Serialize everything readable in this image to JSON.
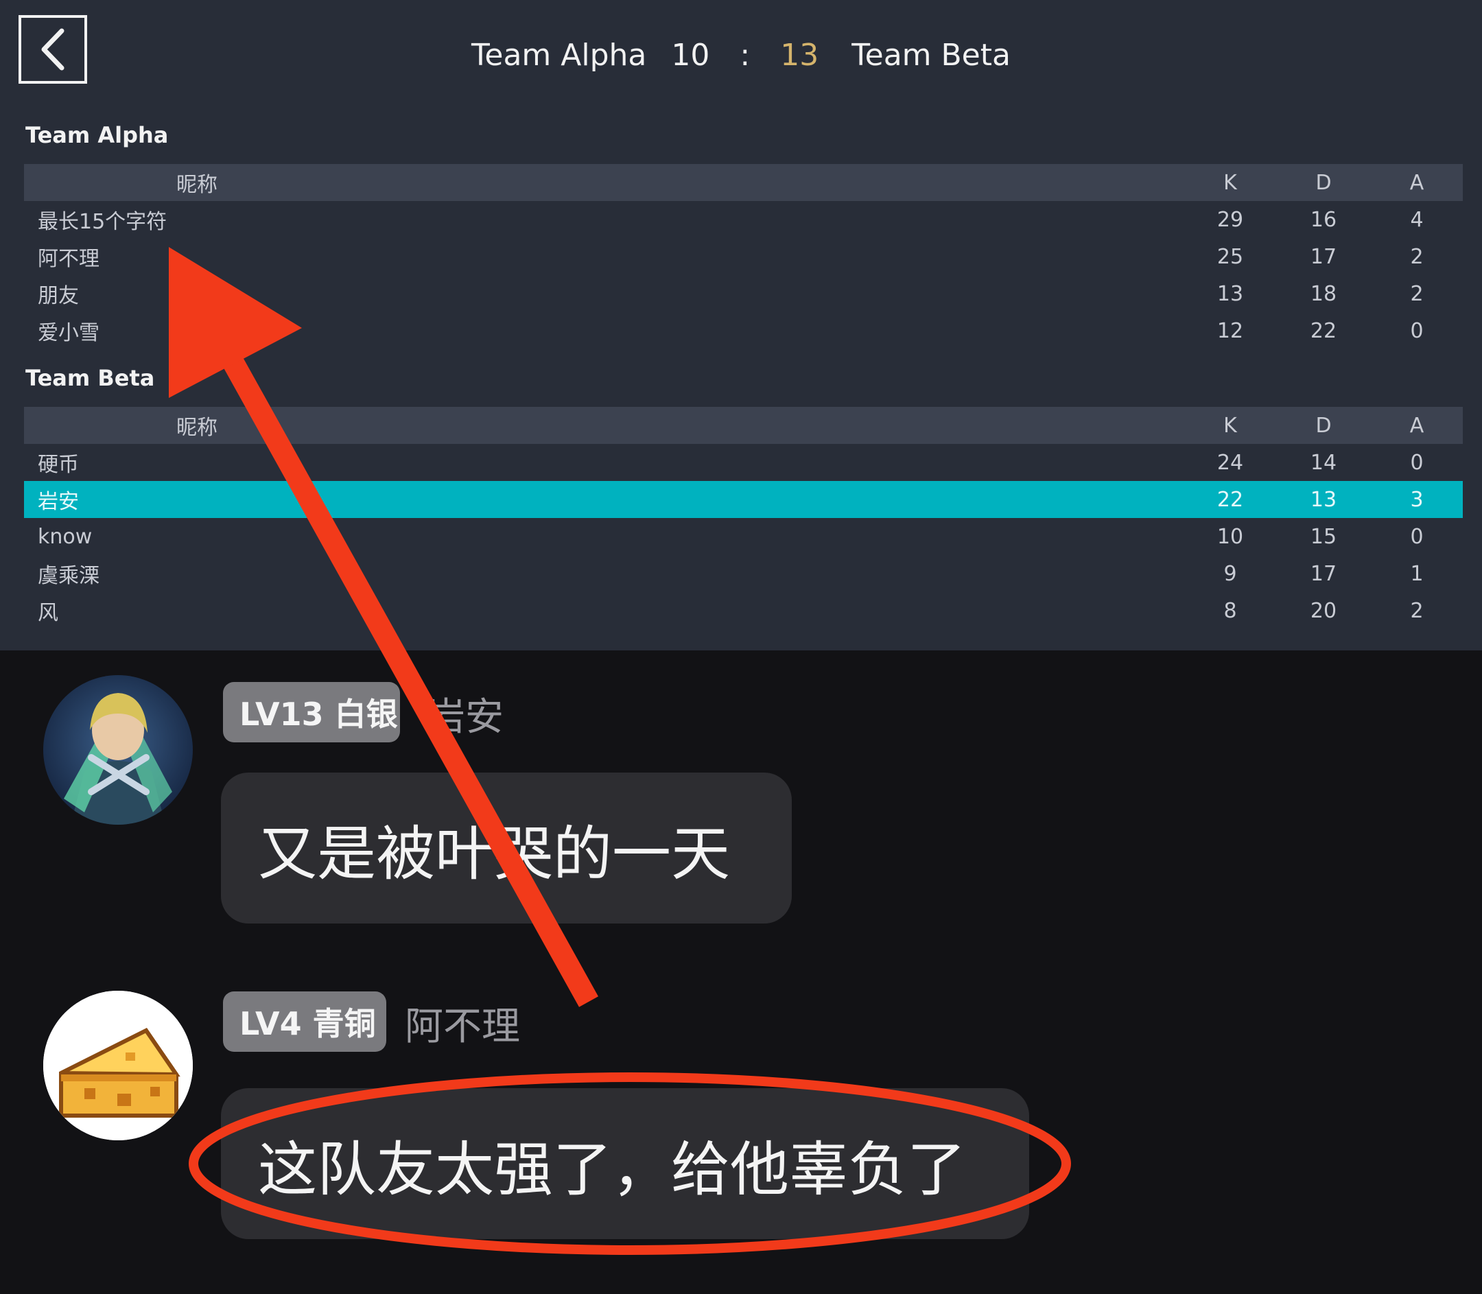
{
  "header": {
    "team_a": "Team Alpha",
    "score_a": "10",
    "separator": ":",
    "score_b": "13",
    "team_b": "Team Beta"
  },
  "teams": [
    {
      "title": "Team Alpha",
      "columns": {
        "name": "昵称",
        "k": "K",
        "d": "D",
        "a": "A"
      },
      "rows": [
        {
          "name": "最长15个字符",
          "k": "29",
          "d": "16",
          "a": "4"
        },
        {
          "name": "阿不理",
          "k": "25",
          "d": "17",
          "a": "2"
        },
        {
          "name": "朋友",
          "k": "13",
          "d": "18",
          "a": "2"
        },
        {
          "name": "爱小雪",
          "k": "12",
          "d": "22",
          "a": "0"
        }
      ]
    },
    {
      "title": "Team Beta",
      "columns": {
        "name": "昵称",
        "k": "K",
        "d": "D",
        "a": "A"
      },
      "rows": [
        {
          "name": "硬币",
          "k": "24",
          "d": "14",
          "a": "0"
        },
        {
          "name": "岩安",
          "k": "22",
          "d": "13",
          "a": "3",
          "highlighted": true
        },
        {
          "name": "know",
          "k": "10",
          "d": "15",
          "a": "0"
        },
        {
          "name": "虞乘溧",
          "k": "9",
          "d": "17",
          "a": "1"
        },
        {
          "name": "风",
          "k": "8",
          "d": "20",
          "a": "2"
        }
      ]
    }
  ],
  "messages": [
    {
      "level_badge": "LV13 白银",
      "username": "岩安",
      "text": "又是被叶哭的一天",
      "avatar_icon": "anime-character-avatar"
    },
    {
      "level_badge": "LV4 青铜",
      "username": "阿不理",
      "text": "这队友太强了，给他辜负了",
      "avatar_icon": "cheese-avatar"
    }
  ],
  "colors": {
    "highlight_row": "#00b2bf",
    "score_b": "#d5b46c",
    "annotation": "#f23a1a"
  }
}
